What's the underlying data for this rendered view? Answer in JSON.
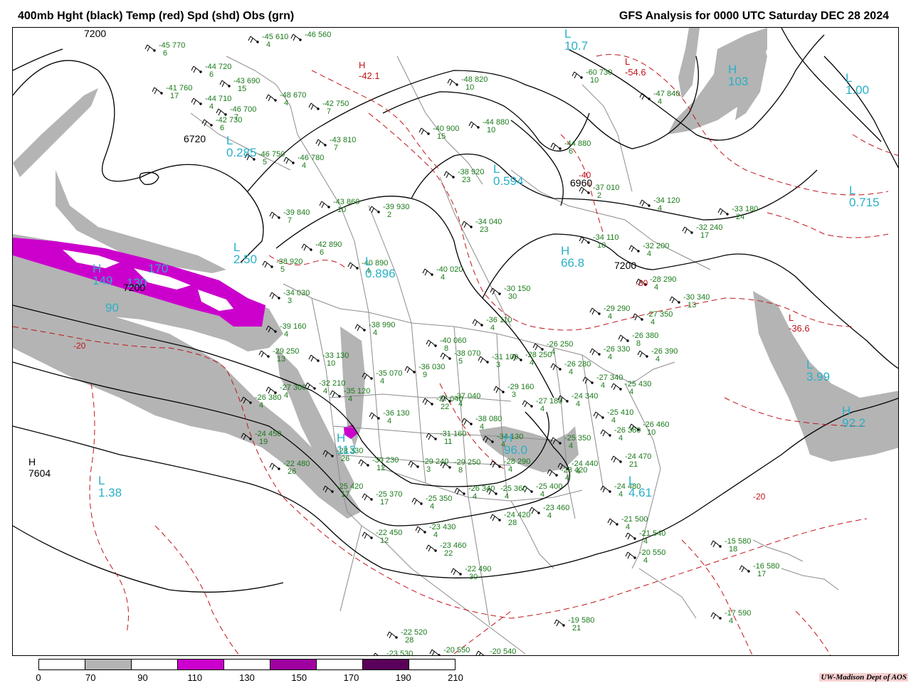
{
  "header": {
    "left_title": "400mb Hght (black) Temp (red) Spd (shd) Obs (grn)",
    "right_title": "GFS Analysis for 0000 UTC Saturday  DEC 28 2024"
  },
  "colors": {
    "height_contour": "#000000",
    "temp_contour": "#c0151a",
    "speed_70_90": "#b4b4b4",
    "speed_110_130": "#cc00cc",
    "speed_130_150": "#a000a0",
    "speed_150_170": "#8a008a",
    "speed_190_210": "#5a005a",
    "obs_text": "#1a7a1a",
    "pressure_centers": "#2ab0c8",
    "border_lines": "#8c8c8c"
  },
  "height_labels": [
    "6720",
    "6960",
    "7200",
    "7200",
    "7200",
    "7604"
  ],
  "height_centers": [
    {
      "label": "H",
      "value": "7604"
    }
  ],
  "temp_labels": [
    "-20",
    "-20",
    "-40",
    "-30"
  ],
  "temp_centers": [
    {
      "label": "H",
      "value": "-42.1"
    },
    {
      "label": "L",
      "value": "-54.6"
    },
    {
      "label": "L",
      "value": "-36.6"
    }
  ],
  "speed_centers": [
    {
      "label": "H",
      "value": "149"
    },
    {
      "label": "L",
      "value": "0.285"
    },
    {
      "label": "L",
      "value": "2.50"
    },
    {
      "label": "L",
      "value": "0.896"
    },
    {
      "label": "L",
      "value": "0.594"
    },
    {
      "label": "L",
      "value": "10.7"
    },
    {
      "label": "H",
      "value": "103"
    },
    {
      "label": "L",
      "value": "1.00"
    },
    {
      "label": "L",
      "value": "0.715"
    },
    {
      "label": "H",
      "value": "66.8"
    },
    {
      "label": "L",
      "value": "3.99"
    },
    {
      "label": "H",
      "value": "92.2"
    },
    {
      "label": "H",
      "value": "96.0"
    },
    {
      "label": "H",
      "value": "113"
    },
    {
      "label": "L",
      "value": "1.38"
    },
    {
      "label": "L",
      "value": "4.61"
    },
    {
      "label": "",
      "value": "90"
    },
    {
      "label": "",
      "value": "130"
    },
    {
      "label": "",
      "value": "170"
    }
  ],
  "observations": [
    {
      "temp": "-45",
      "hgt": "770",
      "dew": "6"
    },
    {
      "temp": "-44",
      "hgt": "720",
      "dew": "6"
    },
    {
      "temp": "-43",
      "hgt": "690",
      "dew": "15"
    },
    {
      "temp": "-41",
      "hgt": "760",
      "dew": "17"
    },
    {
      "temp": "-44",
      "hgt": "710",
      "dew": "4"
    },
    {
      "temp": "-48",
      "hgt": "670",
      "dew": "4"
    },
    {
      "temp": "-46",
      "hgt": "700",
      "dew": "7"
    },
    {
      "temp": "-42",
      "hgt": "730",
      "dew": "6"
    },
    {
      "temp": "-42",
      "hgt": "750",
      "dew": "7"
    },
    {
      "temp": "-43",
      "hgt": "810",
      "dew": "7"
    },
    {
      "temp": "-46",
      "hgt": "750",
      "dew": "5"
    },
    {
      "temp": "-46",
      "hgt": "780",
      "dew": "4"
    },
    {
      "temp": "-48",
      "hgt": "820",
      "dew": "10"
    },
    {
      "temp": "-40",
      "hgt": "900",
      "dew": "15"
    },
    {
      "temp": "-44",
      "hgt": "880",
      "dew": "10"
    },
    {
      "temp": "-44",
      "hgt": "880",
      "dew": "6"
    },
    {
      "temp": "-38",
      "hgt": "920",
      "dew": "23"
    },
    {
      "temp": "-47",
      "hgt": "840",
      "dew": "4"
    },
    {
      "temp": "-60",
      "hgt": "730",
      "dew": "10"
    },
    {
      "temp": "-43",
      "hgt": "860",
      "dew": "10"
    },
    {
      "temp": "-39",
      "hgt": "930",
      "dew": "2"
    },
    {
      "temp": "-34",
      "hgt": "040",
      "dew": "23"
    },
    {
      "temp": "-37",
      "hgt": "010",
      "dew": "2"
    },
    {
      "temp": "-34",
      "hgt": "120",
      "dew": "4"
    },
    {
      "temp": "-33",
      "hgt": "180",
      "dew": "24"
    },
    {
      "temp": "-32",
      "hgt": "240",
      "dew": "17"
    },
    {
      "temp": "-34",
      "hgt": "110",
      "dew": "10"
    },
    {
      "temp": "-32",
      "hgt": "200",
      "dew": "4"
    },
    {
      "temp": "-39",
      "hgt": "840",
      "dew": "7"
    },
    {
      "temp": "-42",
      "hgt": "890",
      "dew": "6"
    },
    {
      "temp": "-40",
      "hgt": "890",
      "dew": "4"
    },
    {
      "temp": "-40",
      "hgt": "020",
      "dew": "4"
    },
    {
      "temp": "-30",
      "hgt": "150",
      "dew": "30"
    },
    {
      "temp": "-28",
      "hgt": "290",
      "dew": "4"
    },
    {
      "temp": "-30",
      "hgt": "340",
      "dew": "13"
    },
    {
      "temp": "-38",
      "hgt": "920",
      "dew": "5"
    },
    {
      "temp": "-34",
      "hgt": "030",
      "dew": "3"
    },
    {
      "temp": "-38",
      "hgt": "990",
      "dew": "4"
    },
    {
      "temp": "-36",
      "hgt": "110",
      "dew": "4"
    },
    {
      "temp": "-29",
      "hgt": "290",
      "dew": "4"
    },
    {
      "temp": "-27",
      "hgt": "350",
      "dew": "4"
    },
    {
      "temp": "-40",
      "hgt": "060",
      "dew": "8"
    },
    {
      "temp": "-38",
      "hgt": "070",
      "dew": "5"
    },
    {
      "temp": "-31",
      "hgt": "100",
      "dew": "3"
    },
    {
      "temp": "-28",
      "hgt": "250",
      "dew": "4"
    },
    {
      "temp": "-26",
      "hgt": "250",
      "dew": "4"
    },
    {
      "temp": "-26",
      "hgt": "330",
      "dew": "4"
    },
    {
      "temp": "-26",
      "hgt": "380",
      "dew": "8"
    },
    {
      "temp": "-26",
      "hgt": "390",
      "dew": "4"
    },
    {
      "temp": "-39",
      "hgt": "160",
      "dew": "4"
    },
    {
      "temp": "-29",
      "hgt": "250",
      "dew": "13"
    },
    {
      "temp": "-33",
      "hgt": "130",
      "dew": "10"
    },
    {
      "temp": "-35",
      "hgt": "070",
      "dew": "4"
    },
    {
      "temp": "-36",
      "hgt": "030",
      "dew": "9"
    },
    {
      "temp": "-26",
      "hgt": "280",
      "dew": "4"
    },
    {
      "temp": "-27",
      "hgt": "340",
      "dew": "4"
    },
    {
      "temp": "-25",
      "hgt": "430",
      "dew": "4"
    },
    {
      "temp": "-27",
      "hgt": "300",
      "dew": "4"
    },
    {
      "temp": "-32",
      "hgt": "210",
      "dew": "4"
    },
    {
      "temp": "-35",
      "hgt": "120",
      "dew": "4"
    },
    {
      "temp": "-37",
      "hgt": "040",
      "dew": "22"
    },
    {
      "temp": "-37",
      "hgt": "040",
      "dew": "4"
    },
    {
      "temp": "-29",
      "hgt": "160",
      "dew": "3"
    },
    {
      "temp": "-24",
      "hgt": "340",
      "dew": "4"
    },
    {
      "temp": "-26",
      "hgt": "380",
      "dew": "4"
    },
    {
      "temp": "-24",
      "hgt": "450",
      "dew": "19"
    },
    {
      "temp": "-36",
      "hgt": "130",
      "dew": "4"
    },
    {
      "temp": "-38",
      "hgt": "080",
      "dew": "4"
    },
    {
      "temp": "-27",
      "hgt": "180",
      "dew": "4"
    },
    {
      "temp": "-25",
      "hgt": "410",
      "dew": "4"
    },
    {
      "temp": "-26",
      "hgt": "380",
      "dew": "4"
    },
    {
      "temp": "-26",
      "hgt": "460",
      "dew": "10"
    },
    {
      "temp": "-31",
      "hgt": "160",
      "dew": "11"
    },
    {
      "temp": "-34",
      "hgt": "130",
      "dew": "4"
    },
    {
      "temp": "-25",
      "hgt": "350",
      "dew": "4"
    },
    {
      "temp": "-28",
      "hgt": "330",
      "dew": "26"
    },
    {
      "temp": "-22",
      "hgt": "480",
      "dew": "26"
    },
    {
      "temp": "-30",
      "hgt": "230",
      "dew": "12"
    },
    {
      "temp": "-29",
      "hgt": "240",
      "dew": "3"
    },
    {
      "temp": "-29",
      "hgt": "250",
      "dew": "8"
    },
    {
      "temp": "-28",
      "hgt": "290",
      "dew": "4"
    },
    {
      "temp": "-24",
      "hgt": "440",
      "dew": "4"
    },
    {
      "temp": "-23",
      "hgt": "420",
      "dew": "4"
    },
    {
      "temp": "-24",
      "hgt": "470",
      "dew": "21"
    },
    {
      "temp": "-25",
      "hgt": "420",
      "dew": "17"
    },
    {
      "temp": "-25",
      "hgt": "370",
      "dew": "17"
    },
    {
      "temp": "-25",
      "hgt": "350",
      "dew": "4"
    },
    {
      "temp": "-26",
      "hgt": "340",
      "dew": "4"
    },
    {
      "temp": "-25",
      "hgt": "360",
      "dew": "4"
    },
    {
      "temp": "-25",
      "hgt": "400",
      "dew": "4"
    },
    {
      "temp": "-24",
      "hgt": "480",
      "dew": "4"
    },
    {
      "temp": "-23",
      "hgt": "460",
      "dew": "4"
    },
    {
      "temp": "-24",
      "hgt": "420",
      "dew": "28"
    },
    {
      "temp": "-22",
      "hgt": "450",
      "dew": "12"
    },
    {
      "temp": "-23",
      "hgt": "430",
      "dew": "4"
    },
    {
      "temp": "-21",
      "hgt": "500",
      "dew": "4"
    },
    {
      "temp": "-21",
      "hgt": "540",
      "dew": "4"
    },
    {
      "temp": "-20",
      "hgt": "550",
      "dew": "4"
    },
    {
      "temp": "-23",
      "hgt": "460",
      "dew": "22"
    },
    {
      "temp": "-22",
      "hgt": "490",
      "dew": "30"
    },
    {
      "temp": "-15",
      "hgt": "580",
      "dew": "18"
    },
    {
      "temp": "-16",
      "hgt": "580",
      "dew": "17"
    },
    {
      "temp": "-17",
      "hgt": "590",
      "dew": "4"
    },
    {
      "temp": "-19",
      "hgt": "580",
      "dew": "21"
    },
    {
      "temp": "-22",
      "hgt": "520",
      "dew": "28"
    },
    {
      "temp": "-23",
      "hgt": "530",
      "dew": ""
    },
    {
      "temp": "-20",
      "hgt": "550",
      "dew": ""
    },
    {
      "temp": "-20",
      "hgt": "540",
      "dew": ""
    },
    {
      "temp": "-45",
      "hgt": "610",
      "dew": "4"
    },
    {
      "temp": "-46",
      "hgt": "560",
      "dew": ""
    }
  ],
  "colorbar": {
    "labels": [
      "0",
      "70",
      "90",
      "110",
      "130",
      "150",
      "170",
      "190",
      "210"
    ],
    "segments": [
      "#ffffff",
      "#b4b4b4",
      "#ffffff",
      "#cc00cc",
      "#ffffff",
      "#a000a0",
      "#ffffff",
      "#5a005a",
      "#ffffff"
    ]
  },
  "credit": "UW-Madison   Dept of AOS"
}
